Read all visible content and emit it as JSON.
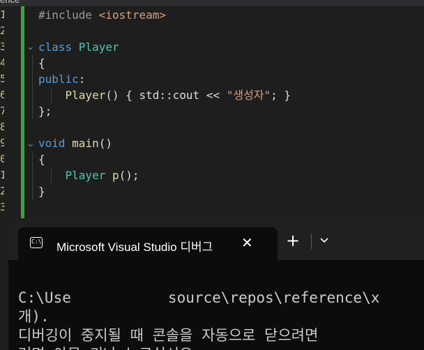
{
  "window": {
    "title_fragment": "ence"
  },
  "editor": {
    "line_markers": [
      "1",
      "2",
      "3",
      "4",
      "5",
      "6",
      "7",
      "8",
      "9",
      "0",
      "1",
      "2",
      "3"
    ],
    "lines": [
      {
        "tokens": [
          {
            "c": "prep",
            "t": "#include "
          },
          {
            "c": "inc",
            "t": "<iostream>"
          }
        ]
      },
      {
        "tokens": []
      },
      {
        "tokens": [
          {
            "c": "kw",
            "t": "class "
          },
          {
            "c": "type",
            "t": "Player"
          }
        ]
      },
      {
        "tokens": [
          {
            "c": "pl",
            "t": "{"
          }
        ]
      },
      {
        "tokens": [
          {
            "c": "kw",
            "t": "public"
          },
          {
            "c": "pl",
            "t": ":"
          }
        ]
      },
      {
        "tokens": [
          {
            "c": "pl",
            "t": "    "
          },
          {
            "c": "fn",
            "t": "Player"
          },
          {
            "c": "pl",
            "t": "() { std::cout << "
          },
          {
            "c": "str",
            "t": "\"생성자\""
          },
          {
            "c": "pl",
            "t": "; }"
          }
        ]
      },
      {
        "tokens": [
          {
            "c": "pl",
            "t": "};"
          }
        ]
      },
      {
        "tokens": []
      },
      {
        "tokens": [
          {
            "c": "kw",
            "t": "void "
          },
          {
            "c": "fn",
            "t": "main"
          },
          {
            "c": "pl",
            "t": "()"
          }
        ]
      },
      {
        "tokens": [
          {
            "c": "pl",
            "t": "{"
          }
        ]
      },
      {
        "tokens": [
          {
            "c": "pl",
            "t": "    "
          },
          {
            "c": "type",
            "t": "Player"
          },
          {
            "c": "pl",
            "t": " "
          },
          {
            "c": "fn",
            "t": "p"
          },
          {
            "c": "pl",
            "t": "();"
          }
        ]
      },
      {
        "tokens": [
          {
            "c": "pl",
            "t": "}"
          }
        ]
      }
    ]
  },
  "terminal": {
    "tab_title": "Microsoft Visual Studio 디버그",
    "tab_icon_text": "C:\\",
    "close_glyph": "✕",
    "new_tab_glyph": "+",
    "output": [
      "C:\\Use           source\\repos\\reference\\x",
      "개).",
      "디버깅이 중지될 때 콘솔을 자동으로 닫으려면",
      "려면 아무 키나 누르십시오..."
    ]
  }
}
